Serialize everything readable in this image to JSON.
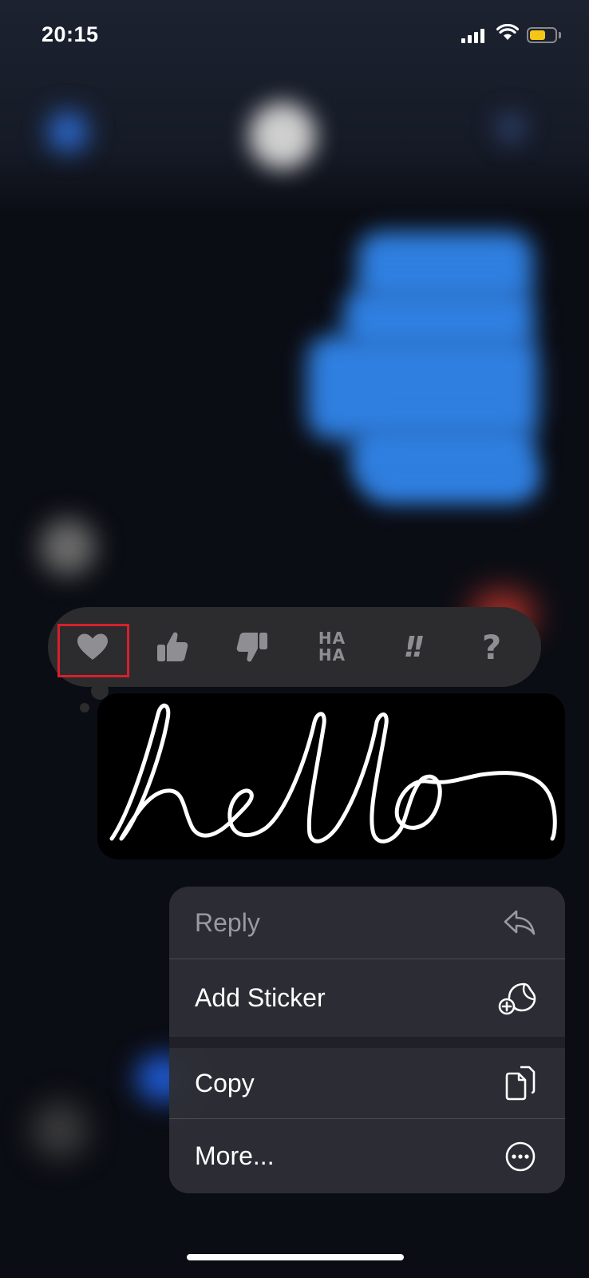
{
  "status_bar": {
    "time": "20:15",
    "battery_level": 0.62,
    "battery_color": "#f5c518",
    "signal_icon": "signal-bars-icon",
    "wifi_icon": "wifi-icon",
    "battery_icon": "battery-icon"
  },
  "tapbacks": [
    {
      "name": "heart",
      "icon": "heart-icon",
      "highlighted": true
    },
    {
      "name": "thumbs-up",
      "icon": "thumbs-up-icon"
    },
    {
      "name": "thumbs-down",
      "icon": "thumbs-down-icon"
    },
    {
      "name": "haha",
      "label_line1": "HA",
      "label_line2": "HA"
    },
    {
      "name": "exclamation",
      "label": "!!"
    },
    {
      "name": "question",
      "label": "?"
    }
  ],
  "message": {
    "type": "handwritten",
    "content": "hello"
  },
  "context_menu": {
    "items": [
      {
        "label": "Reply",
        "icon": "reply-arrow-icon",
        "disabled": true
      },
      {
        "label": "Add Sticker",
        "icon": "add-sticker-icon"
      },
      {
        "label": "Copy",
        "icon": "copy-icon"
      },
      {
        "label": "More...",
        "icon": "more-ellipsis-icon"
      }
    ]
  },
  "colors": {
    "highlight_box": "#d7202b",
    "tapback_icon": "#8e8e93",
    "bubble_blue": "#2f7fe0"
  }
}
